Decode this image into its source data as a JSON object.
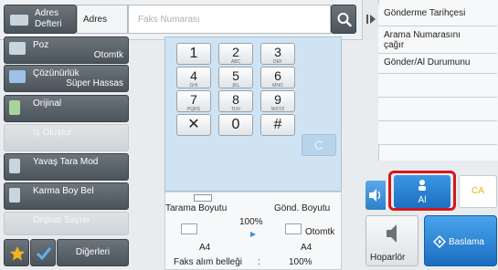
{
  "top": {
    "address_book_label": "Adres\nDefteri",
    "address_label": "Adres",
    "fax_placeholder": "Faks Numarası"
  },
  "left_menu": {
    "resolution_title": "Poz",
    "resolution_value": "Otomtk",
    "quality_title": "Çözünürlük",
    "quality_value": "Süper Hassas",
    "original_title": "Orijinal",
    "job_build_title": "İş Oluştur",
    "slow_scan_title": "Yavaş Tara Mod",
    "mixed_size_title": "Karma Boy Bel",
    "original_count_title": "Orijinal Sayısı",
    "others_label": "Diğerleri"
  },
  "keypad": {
    "keys": [
      {
        "d": "1",
        "s": ""
      },
      {
        "d": "2",
        "s": "ABC"
      },
      {
        "d": "3",
        "s": "DEF"
      },
      {
        "d": "4",
        "s": "GHI"
      },
      {
        "d": "5",
        "s": "JKL"
      },
      {
        "d": "6",
        "s": "MNO"
      },
      {
        "d": "7",
        "s": "PQRS"
      },
      {
        "d": "8",
        "s": "TUV"
      },
      {
        "d": "9",
        "s": "WXYZ"
      },
      {
        "d": "✕",
        "s": ""
      },
      {
        "d": "0",
        "s": ""
      },
      {
        "d": "#",
        "s": ""
      }
    ],
    "clear_label": "C"
  },
  "scan_info": {
    "scan_size_label": "Tarama Boyutu",
    "send_size_label": "Gönd. Boyutu",
    "ratio": "100%",
    "scan_size_value": "A4",
    "send_size_mode": "Otomtk",
    "send_size_value": "A4",
    "memory_label": "Faks alım belleği",
    "memory_sep": ":",
    "memory_value": "100%"
  },
  "right_panel": {
    "items": [
      "Gönderme Tarihçesi",
      "Arama Numarasını\nçağır",
      "Gönder/Al Durumunu",
      "",
      "",
      ""
    ]
  },
  "bottom_right": {
    "receive_label": "Al",
    "ca_label": "CA",
    "speaker_label": "Hoparlör",
    "start_label": "Baslama"
  },
  "colors": {
    "accent_blue": "#1b74c9",
    "highlight_red": "#d5171e",
    "ca_yellow": "#f2d21a",
    "keypad_bg": "#cfe3f3"
  }
}
